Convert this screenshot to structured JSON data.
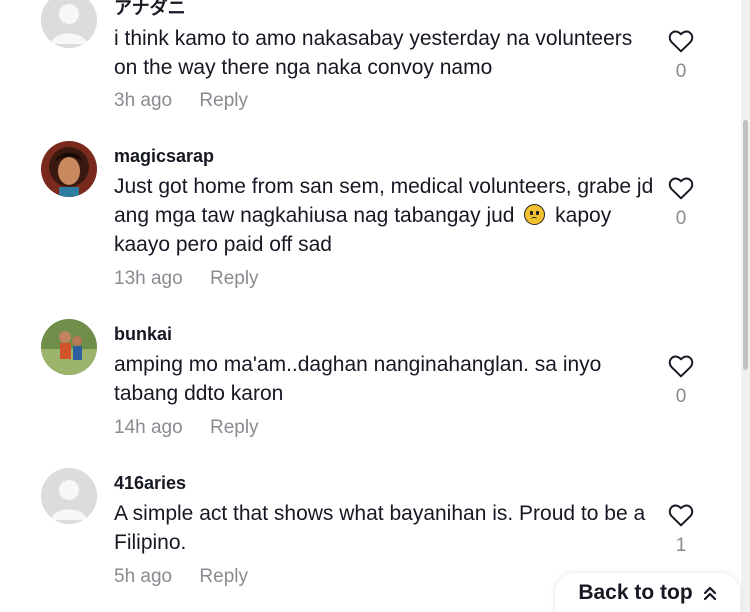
{
  "comments": [
    {
      "username": "アナダニ",
      "text": "i think kamo to amo nakasabay yesterday na volunteers on the way there nga naka convoy namo",
      "time": "3h ago",
      "reply_label": "Reply",
      "likes": "0",
      "avatar": "default-avatar-icon"
    },
    {
      "username": "magicsarap",
      "text_before": "Just got home from san sem, medical volunteers, grabe jd ang mga taw nagkahiusa nag tabangay jud",
      "text_after": "kapoy kaayo pero paid off sad",
      "emoji": "pleading-face-emoji",
      "time": "13h ago",
      "reply_label": "Reply",
      "likes": "0",
      "avatar": "user-photo-avatar"
    },
    {
      "username": "bunkai",
      "text": "amping mo ma'am..daghan nanginahanglan. sa inyo tabang ddto karon",
      "time": "14h ago",
      "reply_label": "Reply",
      "likes": "0",
      "avatar": "user-photo-avatar"
    },
    {
      "username": "416aries",
      "text": "A simple act that shows what bayanihan is. Proud to be a Filipino.",
      "time": "5h ago",
      "reply_label": "Reply",
      "likes": "1",
      "avatar": "default-avatar-icon"
    }
  ],
  "back_to_top": {
    "label": "Back to top",
    "icon": "double-chevron-up-icon"
  },
  "colors": {
    "text": "#161823",
    "muted": "#8a8b91",
    "background": "#ffffff"
  }
}
